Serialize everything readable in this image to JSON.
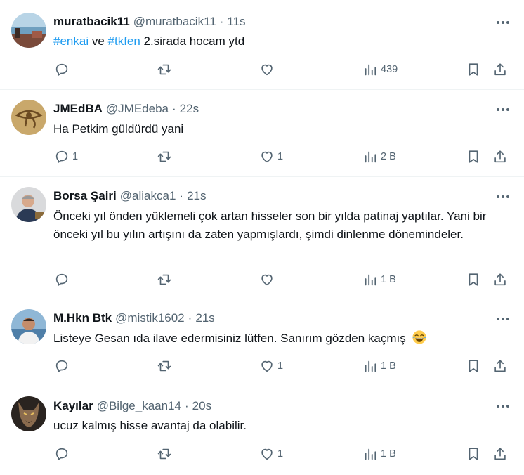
{
  "colors": {
    "text": "#0f1419",
    "secondary": "#536471",
    "link": "#1d9bf0",
    "divider": "#eff3f4"
  },
  "tweets": [
    {
      "name": "muratbacik11",
      "handle": "@muratbacik11",
      "sep": "·",
      "time": "11s",
      "hashtag1": "#enkai",
      "mid": " ve ",
      "hashtag2": "#tkfen",
      "rest": " 2.sirada hocam ytd",
      "reply_count": "",
      "retweet_count": "",
      "like_count": "",
      "view_count": "439",
      "avatar": "sea-landscape-avatar"
    },
    {
      "name": "JMEdBA",
      "handle": "@JMEdeba",
      "sep": "·",
      "time": "22s",
      "text": "Ha Petkim güldürdü yani",
      "reply_count": "1",
      "retweet_count": "",
      "like_count": "1",
      "view_count": "2 B",
      "avatar": "eye-of-horus-avatar"
    },
    {
      "name": "Borsa Şairi",
      "handle": "@aliakca1",
      "sep": "·",
      "time": "21s",
      "text": "Önceki yıl önden yüklemeli çok artan hisseler son bir yılda patinaj yaptılar. Yani bir önceki yıl bu yılın artışını da zaten yapmışlardı, şimdi dinlenme dönemindeler.",
      "reply_count": "",
      "retweet_count": "",
      "like_count": "",
      "view_count": "1 B",
      "avatar": "man-portrait-avatar"
    },
    {
      "name": "M.Hkn Btk",
      "handle": "@mistik1602",
      "sep": "·",
      "time": "21s",
      "text": "Listeye Gesan ıda ilave edermisiniz lütfen. Sanırım gözden kaçmış",
      "emoji": "tears-of-joy-emoji",
      "reply_count": "",
      "retweet_count": "",
      "like_count": "1",
      "view_count": "1 B",
      "avatar": "man-seaside-avatar"
    },
    {
      "name": "Kayılar",
      "handle": "@Bilge_kaan14",
      "sep": "·",
      "time": "20s",
      "text": "ucuz kalmış hisse avantaj da olabilir.",
      "reply_count": "",
      "retweet_count": "",
      "like_count": "1",
      "view_count": "1 B",
      "avatar": "wolf-avatar"
    }
  ]
}
